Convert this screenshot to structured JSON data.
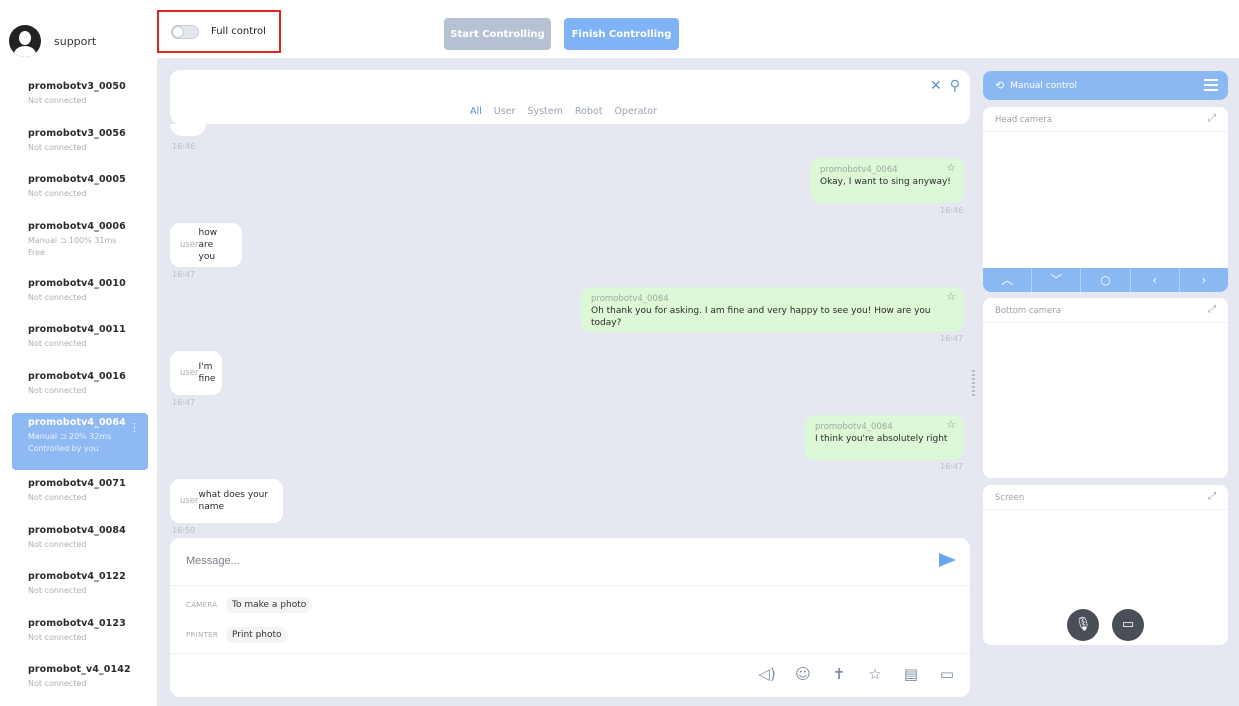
{
  "user": {
    "name": "support"
  },
  "robots": [
    {
      "name": "promobotv3_0050",
      "status": "Not connected"
    },
    {
      "name": "promobotv3_0056",
      "status": "Not connected"
    },
    {
      "name": "promobotv4_0005",
      "status": "Not connected"
    },
    {
      "name": "promobotv4_0006",
      "status": "Manual  ⊐ 100%  31ms",
      "sub": "Free"
    },
    {
      "name": "promobotv4_0010",
      "status": "Not connected"
    },
    {
      "name": "promobotv4_0011",
      "status": "Not connected"
    },
    {
      "name": "promobotv4_0016",
      "status": "Not connected"
    },
    {
      "name": "promobotv4_0064",
      "status": "Manual  ⊐ 20%  32ms",
      "sub": "Controlled by you",
      "active": true
    },
    {
      "name": "promobotv4_0071",
      "status": "Not connected"
    },
    {
      "name": "promobotv4_0084",
      "status": "Not connected"
    },
    {
      "name": "promobotv4_0122",
      "status": "Not connected"
    },
    {
      "name": "promobotv4_0123",
      "status": "Not connected"
    },
    {
      "name": "promobot_v4_0142",
      "status": "Not connected"
    }
  ],
  "topbar": {
    "full_control_label": "Full control",
    "start_label": "Start Controlling",
    "finish_label": "Finish Controlling"
  },
  "filters": {
    "tabs": [
      "All",
      "User",
      "System",
      "Robot",
      "Operator"
    ],
    "active": "All"
  },
  "messages": {
    "t0": "16:46",
    "m1": {
      "from": "promobotv4_0064",
      "text": "Okay, I want to sing anyway!",
      "time": "16:46"
    },
    "m2": {
      "from": "user",
      "text": "how are you",
      "time": "16:47"
    },
    "m3": {
      "from": "promobotv4_0064",
      "text": "Oh thank you for asking. I am fine and very happy to see you! How are you today?",
      "time": "16:47"
    },
    "m4": {
      "from": "user",
      "text": "I'm fine",
      "time": "16:47"
    },
    "m5": {
      "from": "promobotv4_0064",
      "text": "I think you're absolutely right",
      "time": "16:47"
    },
    "m6": {
      "from": "user",
      "text": "what does your name",
      "time": "16:50"
    }
  },
  "composer": {
    "placeholder": "Message...",
    "quick": [
      {
        "label": "CAMERA",
        "chip": "To make a photo"
      },
      {
        "label": "PRINTER",
        "chip": "Print photo"
      }
    ]
  },
  "right_panel": {
    "manual_control_label": "Manual control",
    "head_camera": "Head camera",
    "bottom_camera": "Bottom camera",
    "screen": "Screen"
  },
  "colors": {
    "accent": "#8ab8f3",
    "robot_bubble": "#ddf8d6",
    "highlight_border": "#e02323"
  }
}
